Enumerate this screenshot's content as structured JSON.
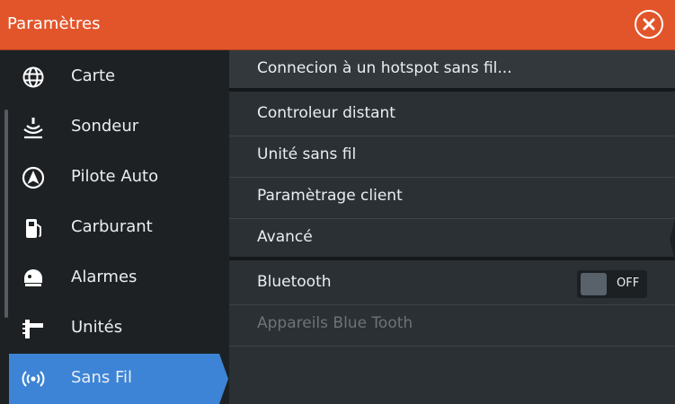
{
  "window": {
    "title": "Paramètres",
    "accent_color": "#e2552a",
    "close_icon": "close-circle-icon"
  },
  "sidebar": {
    "items": [
      {
        "label": "Carte",
        "icon": "globe-icon"
      },
      {
        "label": "Sondeur",
        "icon": "sonar-icon"
      },
      {
        "label": "Pilote Auto",
        "icon": "autopilot-icon"
      },
      {
        "label": "Carburant",
        "icon": "fuel-pump-icon"
      },
      {
        "label": "Alarmes",
        "icon": "alarm-icon"
      },
      {
        "label": "Unités",
        "icon": "units-icon"
      },
      {
        "label": "Sans Fil",
        "icon": "wireless-icon",
        "selected": true
      }
    ],
    "selected_color": "#3d84d6"
  },
  "main": {
    "rows": [
      {
        "label": "Connecion à un hotspot sans fil..."
      },
      {
        "label": "Controleur distant"
      },
      {
        "label": "Unité sans fil"
      },
      {
        "label": "Paramètrage client"
      },
      {
        "label": "Avancé"
      },
      {
        "label": "Bluetooth",
        "toggle": "OFF"
      },
      {
        "label": "Appareils Blue Tooth",
        "disabled": true
      }
    ]
  }
}
